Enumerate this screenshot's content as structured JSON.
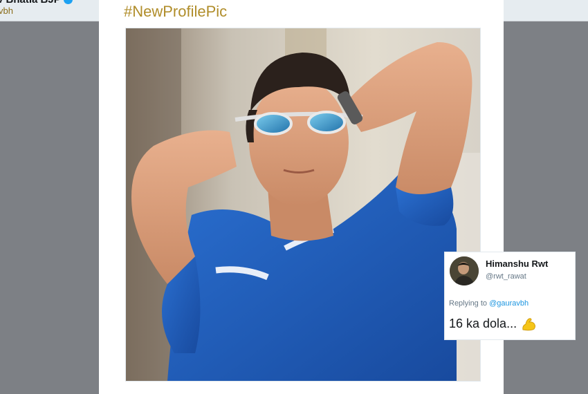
{
  "background_tweet": {
    "author_name": "v Bhatia BJP",
    "handle": "vbh"
  },
  "tweet": {
    "hashtag": "#NewProfilePic",
    "photo_icon": "profile-photo"
  },
  "reply": {
    "author_name": "Himanshu Rwt",
    "handle": "@rwt_rawat",
    "replying_prefix": "Replying to",
    "replying_to": "@gauravbh",
    "text": "16 ka dola...",
    "emoji_icon": "flexed-biceps-icon"
  },
  "colors": {
    "hashtag": "#b08d2a",
    "link": "#1b95e0",
    "overlay": "#7d8085",
    "shirt": "#1f5fc0"
  }
}
